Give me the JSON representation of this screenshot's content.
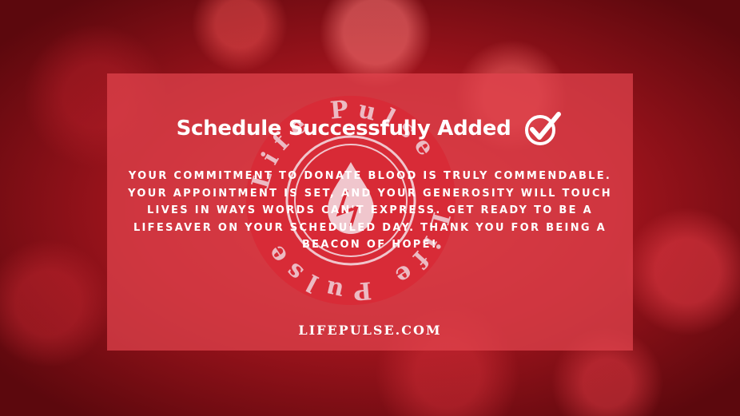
{
  "notice": {
    "title": "Schedule Successfully Added",
    "icon": "check-circle-icon",
    "message": "YOUR COMMITMENT TO DONATE BLOOD IS TRULY COMMENDABLE. YOUR APPOINTMENT IS SET, AND YOUR GENEROSITY WILL TOUCH LIVES IN WAYS WORDS CAN'T EXPRESS. GET READY TO BE A LIFESAVER ON YOUR SCHEDULED DAY. THANK YOU FOR BEING A BEACON OF HOPE!",
    "website": "LIFEPULSE.COM"
  },
  "watermark": {
    "text": "Life Pulse",
    "icon": "blood-drop-icon"
  },
  "colors": {
    "background": "#a0141d",
    "card": "#e2444e",
    "logo_red": "#d82a36",
    "logo_ring": "#f3d7de",
    "text": "#ffffff"
  }
}
